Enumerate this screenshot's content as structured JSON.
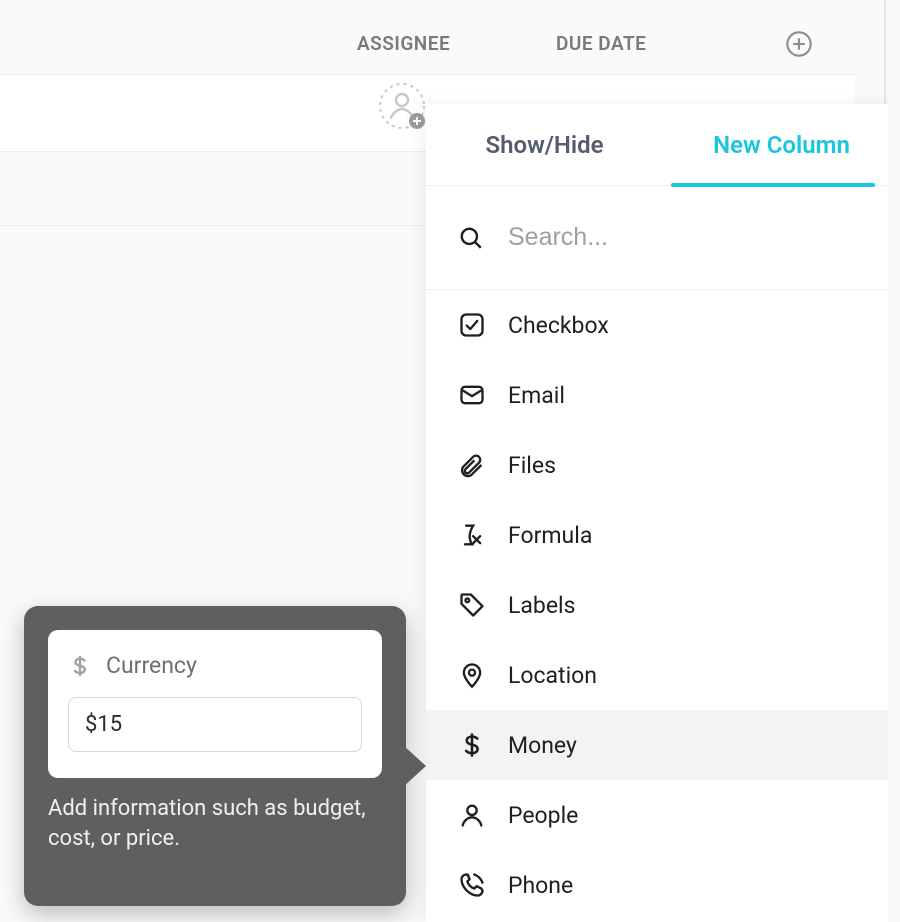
{
  "columns": {
    "assignee_label": "ASSIGNEE",
    "due_date_label": "DUE DATE"
  },
  "panel": {
    "tabs": {
      "show_hide": "Show/Hide",
      "new_column": "New Column"
    },
    "search_placeholder": "Search...",
    "options": [
      {
        "id": "checkbox",
        "label": "Checkbox",
        "icon": "checkbox-icon",
        "selected": false
      },
      {
        "id": "email",
        "label": "Email",
        "icon": "email-icon",
        "selected": false
      },
      {
        "id": "files",
        "label": "Files",
        "icon": "files-icon",
        "selected": false
      },
      {
        "id": "formula",
        "label": "Formula",
        "icon": "formula-icon",
        "selected": false
      },
      {
        "id": "labels",
        "label": "Labels",
        "icon": "labels-icon",
        "selected": false
      },
      {
        "id": "location",
        "label": "Location",
        "icon": "location-icon",
        "selected": false
      },
      {
        "id": "money",
        "label": "Money",
        "icon": "money-icon",
        "selected": true
      },
      {
        "id": "people",
        "label": "People",
        "icon": "people-icon",
        "selected": false
      },
      {
        "id": "phone",
        "label": "Phone",
        "icon": "phone-icon",
        "selected": false
      }
    ]
  },
  "tooltip": {
    "preview_title": "Currency",
    "preview_value": "$15",
    "description": "Add information such as budget, cost, or price."
  }
}
